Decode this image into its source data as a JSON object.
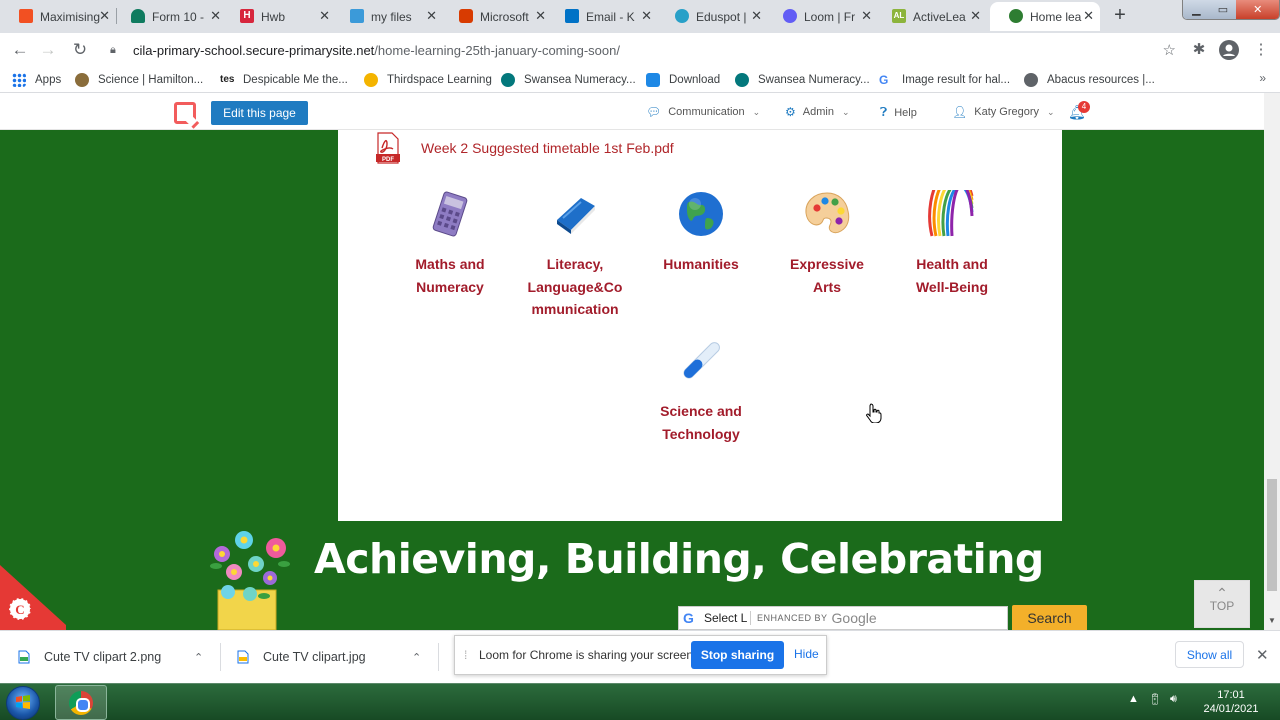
{
  "browser": {
    "tabs": [
      {
        "title": "Maximising",
        "icon": "maximising-favicon",
        "color": "#f25022"
      },
      {
        "title": "Form 10 -",
        "icon": "form-favicon",
        "color": "#0f7b5f"
      },
      {
        "title": "Hwb",
        "icon": "hwb-favicon",
        "color": "#d7263d"
      },
      {
        "title": "my files",
        "icon": "files-favicon",
        "color": "#3b9ad9"
      },
      {
        "title": "Microsoft",
        "icon": "office-favicon",
        "color": "#d83b01"
      },
      {
        "title": "Email - K",
        "icon": "outlook-favicon",
        "color": "#0072c6"
      },
      {
        "title": "Eduspot |",
        "icon": "eduspot-favicon",
        "color": "#28a0c8"
      },
      {
        "title": "Loom | Fr",
        "icon": "loom-favicon",
        "color": "#625df5"
      },
      {
        "title": "ActiveLea",
        "icon": "activelearn-favicon",
        "color": "#8cb43c"
      },
      {
        "title": "Home lea",
        "icon": "school-favicon",
        "color": "#2e7d32"
      }
    ],
    "url_host": "cila-primary-school.secure-primarysite.net",
    "url_path": "/home-learning-25th-january-coming-soon/",
    "bookmarks": [
      {
        "label": "Apps",
        "icon": "apps-grid-icon",
        "color": "#1a73e8"
      },
      {
        "label": "Science | Hamilton...",
        "icon": "hamilton-icon",
        "color": "#8a6d3b"
      },
      {
        "label": "Despicable Me the...",
        "icon": "tes-icon",
        "color": "#222222"
      },
      {
        "label": "Thirdspace Learning",
        "icon": "thirdspace-icon",
        "color": "#f4b400"
      },
      {
        "label": "Swansea Numeracy...",
        "icon": "sharepoint-icon",
        "color": "#03787c"
      },
      {
        "label": "Download",
        "icon": "download-icon",
        "color": "#1e88e5"
      },
      {
        "label": "Swansea Numeracy...",
        "icon": "sharepoint-icon",
        "color": "#03787c"
      },
      {
        "label": "Image result for hal...",
        "icon": "google-icon",
        "color": "#4285f4"
      },
      {
        "label": "Abacus resources |...",
        "icon": "globe-icon",
        "color": "#5f6368"
      }
    ]
  },
  "site_admin": {
    "edit_label": "Edit this page",
    "communication": "Communication",
    "admin": "Admin",
    "help": "Help",
    "user": "Katy Gregory",
    "notification_count": "4"
  },
  "content": {
    "pdf_label": "Week 2 Suggested timetable 1st Feb.pdf",
    "pdf_badge": "PDF",
    "subjects": [
      {
        "line1": "Maths and",
        "line2": "Numeracy",
        "line3": "",
        "icon": "calculator-icon"
      },
      {
        "line1": "Literacy,",
        "line2": "Language&Co",
        "line3": "mmunication",
        "icon": "book-icon"
      },
      {
        "line1": "Humanities",
        "line2": "",
        "line3": "",
        "icon": "globe-earth-icon"
      },
      {
        "line1": "Expressive",
        "line2": "Arts",
        "line3": "",
        "icon": "paint-palette-icon"
      },
      {
        "line1": "Health and",
        "line2": "Well-Being",
        "line3": "",
        "icon": "rainbow-icon"
      },
      {
        "line1": "Science and",
        "line2": "Technology",
        "line3": "",
        "icon": "test-tube-icon"
      }
    ]
  },
  "footer": {
    "motto": "Achieving, Building, Celebrating",
    "translate_label": "Select L",
    "enhanced_by": "ENHANCED BY",
    "google_text": "Google",
    "search_label": "Search",
    "top_label": "TOP",
    "corner_badge": "C"
  },
  "downloads": {
    "items": [
      "Cute TV clipart 2.png",
      "Cute TV clipart.jpg"
    ],
    "show_all": "Show all"
  },
  "screen_share": {
    "message": "Loom for Chrome is sharing your screen.",
    "stop_label": "Stop sharing",
    "hide_label": "Hide"
  },
  "taskbar": {
    "time": "17:01",
    "date": "24/01/2021"
  },
  "colors": {
    "page_background": "#1b6b1b",
    "subject_text": "#a21c2b",
    "pdf_link": "#b0262a",
    "edit_button": "#1f7bc1",
    "search_button": "#f3b02a"
  }
}
